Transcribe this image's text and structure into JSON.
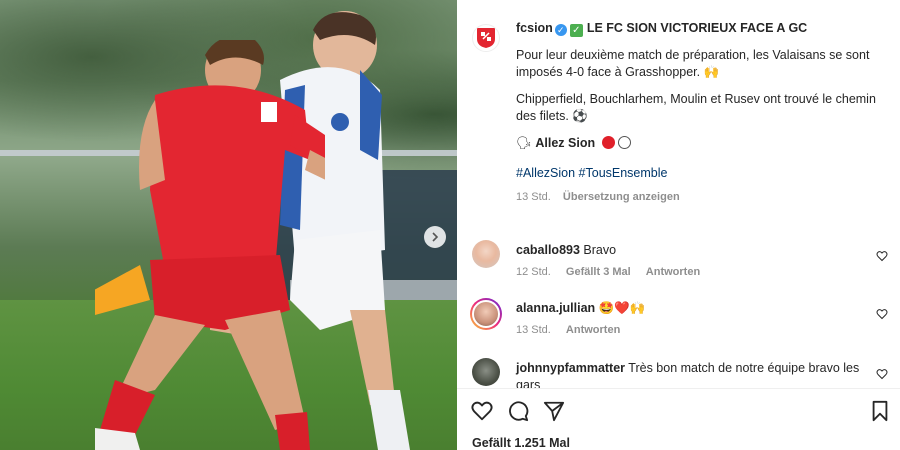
{
  "post": {
    "author": "fcsion",
    "headline": "LE FC SION VICTORIEUX FACE A GC",
    "paragraph1": "Pour leur deuxième match de préparation, les Valaisans se sont imposés 4-0 face à Grasshopper. 🙌",
    "paragraph2": "Chipperfield, Bouchlarhem, Moulin et Rusev ont trouvé le chemin des filets. ⚽",
    "cheer": "Allez Sion",
    "hashtags": "#AllezSion #TousEnsemble",
    "time": "13 Std.",
    "translate": "Übersetzung anzeigen"
  },
  "comments": [
    {
      "user": "caballo893",
      "text": "Bravo",
      "time": "12 Std.",
      "likes": "Gefällt 3 Mal",
      "reply": "Antworten"
    },
    {
      "user": "alanna.jullian",
      "text": "🤩❤️🙌",
      "time": "13 Std.",
      "reply": "Antworten"
    },
    {
      "user": "johnnypfammatter",
      "text": "Très bon match de notre équipe bravo les gars"
    }
  ],
  "footer": {
    "likes": "Gefällt 1.251 Mal"
  },
  "colors": {
    "link": "#00376b",
    "verified": "#3897f0",
    "sion_red": "#e0202a"
  },
  "icons": [
    "club-logo-icon",
    "verified-icon",
    "check-box-icon",
    "speaker-icon",
    "heart-icon",
    "comment-icon",
    "share-icon",
    "bookmark-icon",
    "next-arrow-icon"
  ]
}
